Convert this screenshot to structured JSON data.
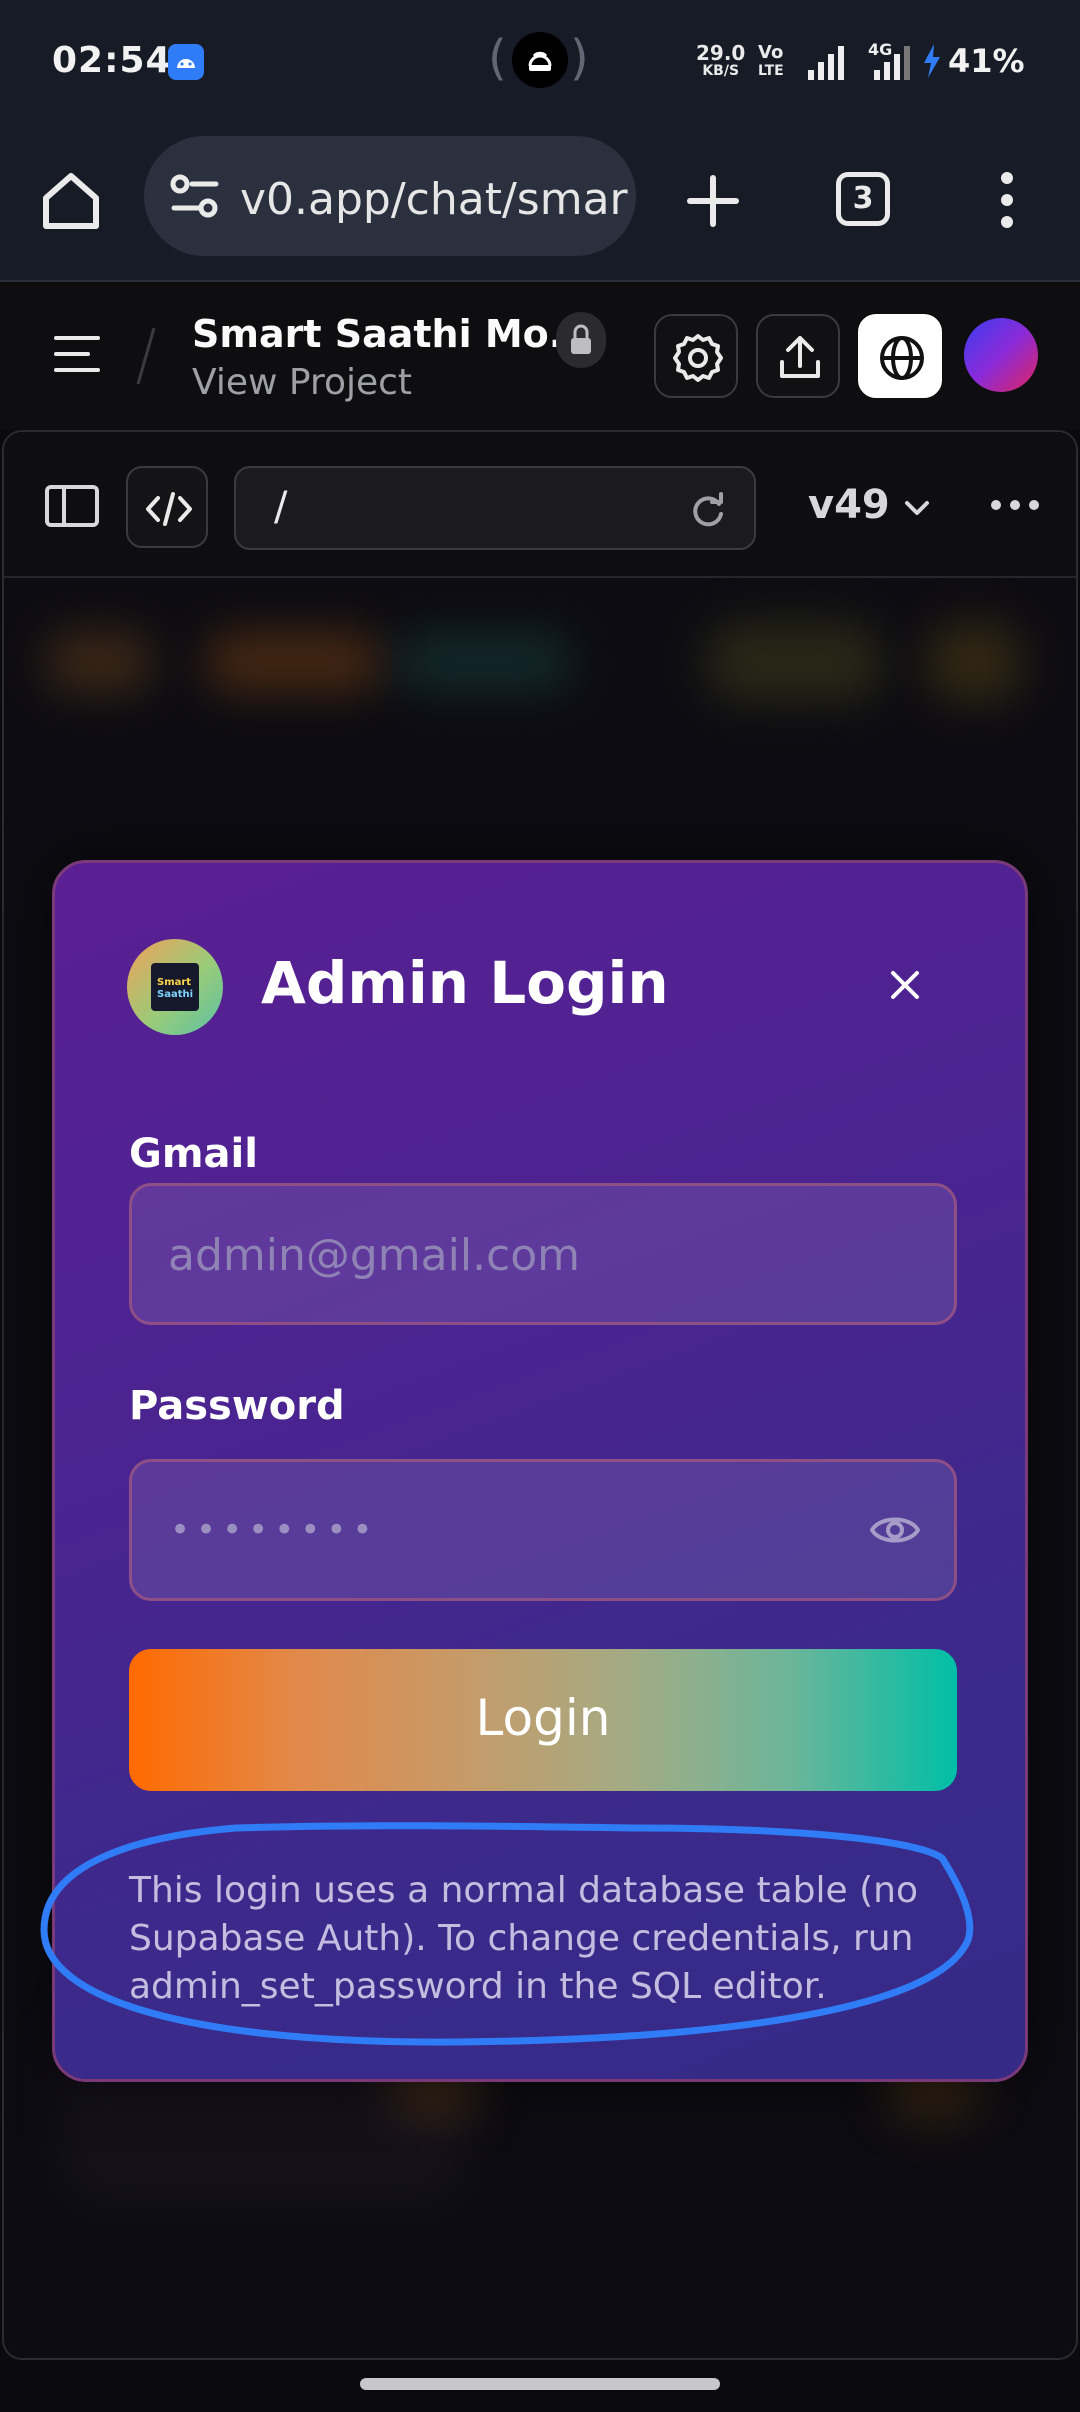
{
  "status_bar": {
    "time": "02:54",
    "net_speed_value": "29.0",
    "net_speed_unit": "KB/S",
    "volte_top": "Vo",
    "volte_bottom": "LTE",
    "network": "4G",
    "battery": "41%"
  },
  "browser": {
    "url": "v0.app/chat/smar",
    "tab_count": "3"
  },
  "header": {
    "project_title": "Smart Saathi Mo...",
    "project_subtitle": "View Project"
  },
  "preview_toolbar": {
    "path": "/",
    "version": "v49"
  },
  "modal": {
    "logo_text_top": "Smart",
    "logo_text_bottom": "Saathi",
    "title": "Admin Login",
    "gmail_label": "Gmail",
    "gmail_placeholder": "admin@gmail.com",
    "password_label": "Password",
    "password_mask": "••••••••",
    "login_button": "Login",
    "note": "This login uses a normal database table (no Supabase Auth). To change credentials, run admin_set_password in the SQL editor."
  },
  "colors": {
    "accent_orange": "#ff6a00",
    "accent_teal": "#00bfa6",
    "modal_purple": "#4a2490",
    "annotation_blue": "#2f7cf6"
  }
}
